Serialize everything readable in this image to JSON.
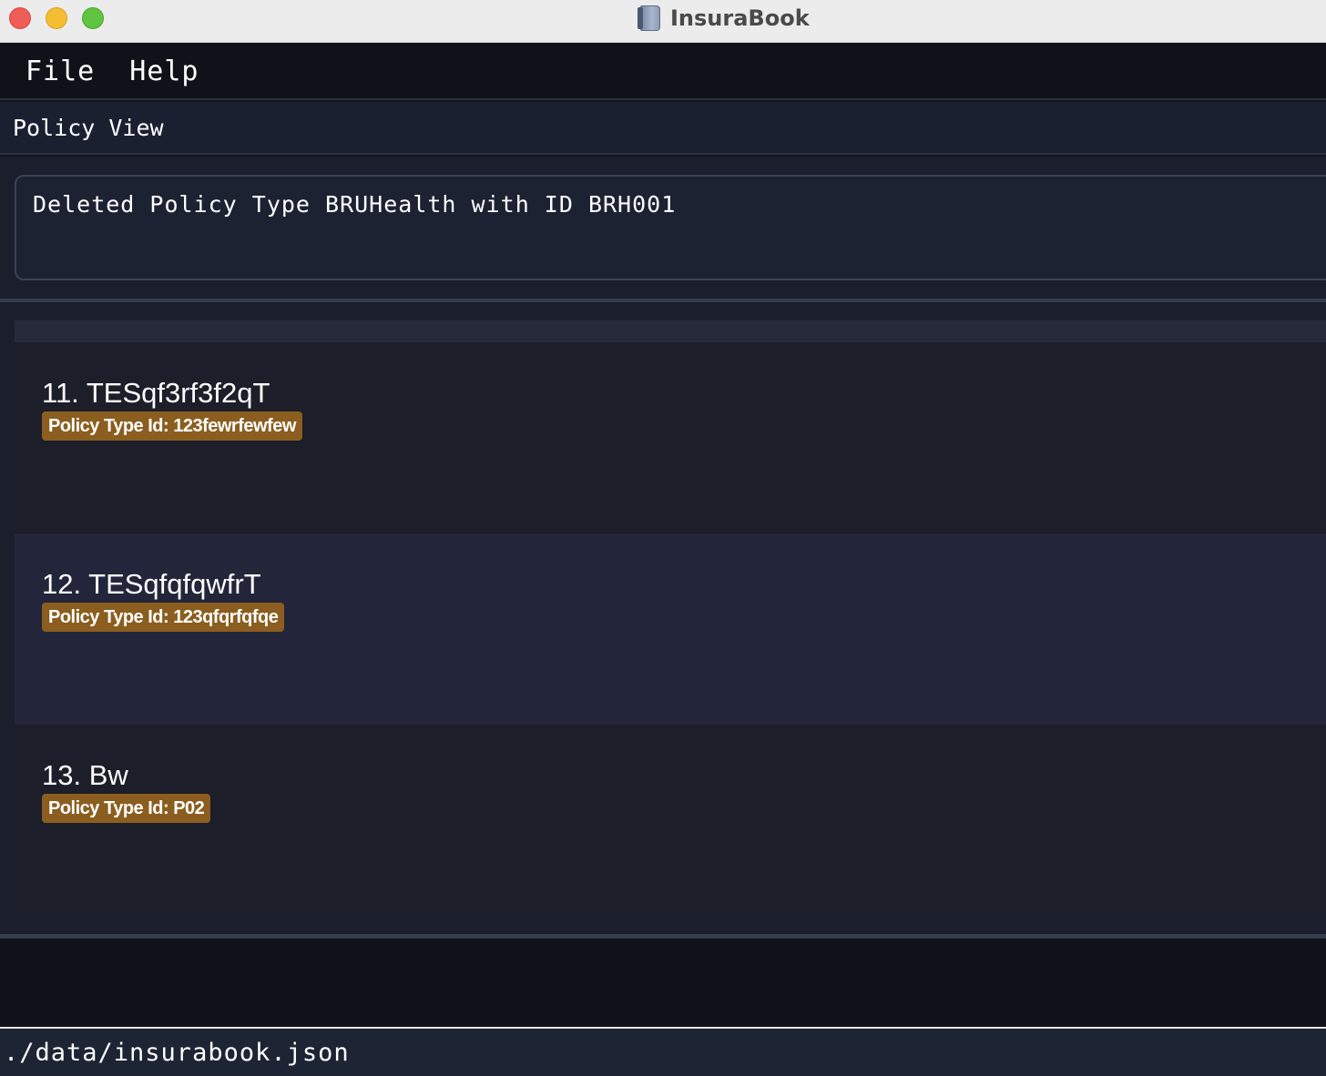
{
  "window": {
    "title": "InsuraBook",
    "app_icon": "notebook-icon"
  },
  "menu": {
    "items": [
      {
        "label": "File"
      },
      {
        "label": "Help"
      }
    ]
  },
  "view": {
    "header": "Policy View"
  },
  "result": {
    "message": "Deleted Policy Type BRUHealth with ID BRH001"
  },
  "policies": [
    {
      "index_name": "11. TESqf3rf3f2qT",
      "tag": "Policy Type Id: 123fewrfewfew"
    },
    {
      "index_name": "12. TESqfqfqwfrT",
      "tag": "Policy Type Id: 123qfqrfqfqe"
    },
    {
      "index_name": "13. Bw",
      "tag": "Policy Type Id: P02"
    }
  ],
  "status": {
    "file_path": "./data/insurabook.json"
  },
  "colors": {
    "tag_background": "#8b5e1f",
    "traffic_close": "#ee5d57",
    "traffic_minimize": "#f5bd32",
    "traffic_zoom": "#5fc43f"
  }
}
